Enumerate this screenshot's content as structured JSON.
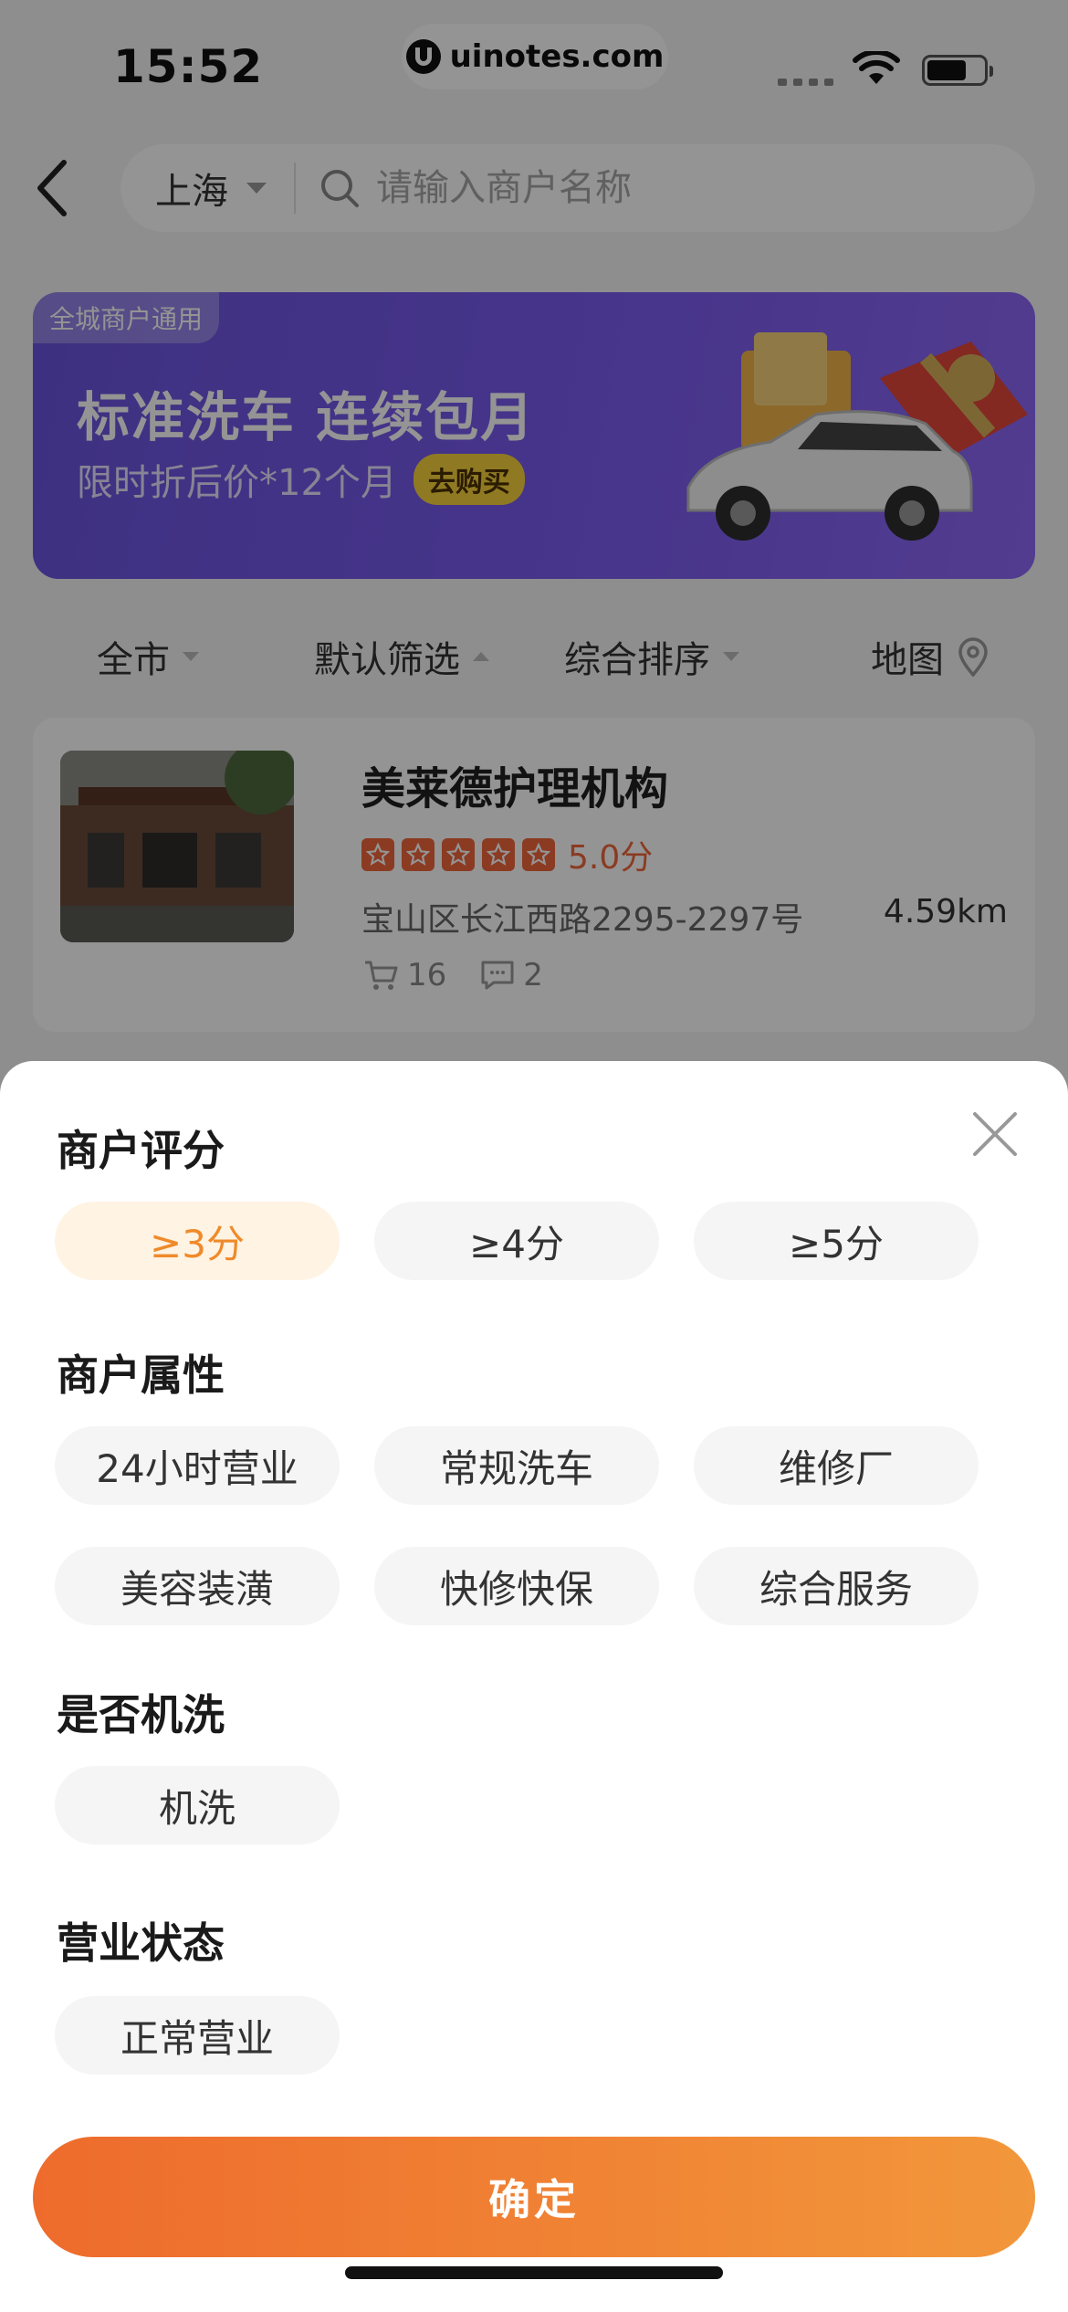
{
  "status_bar": {
    "time": "15:52",
    "watermark": "uinotes.com"
  },
  "search": {
    "city": "上海",
    "placeholder": "请输入商户名称"
  },
  "banner": {
    "tag": "全城商户通用",
    "title": "标准洗车 连续包月",
    "subtitle": "限时折后价*12个月",
    "button": "去购买"
  },
  "filters": [
    {
      "label": "全市"
    },
    {
      "label": "默认筛选"
    },
    {
      "label": "综合排序"
    },
    {
      "label": "地图"
    }
  ],
  "merchant": {
    "name": "美莱德护理机构",
    "rating": 5,
    "rating_max": 5,
    "score_text": "5.0分",
    "address": "宝山区长江西路2295-2297号",
    "distance": "4.59km",
    "orders": "16",
    "comments": "2"
  },
  "sheet": {
    "sections": [
      {
        "title": "商户评分",
        "options": [
          "≥3分",
          "≥4分",
          "≥5分"
        ],
        "selected": "≥3分"
      },
      {
        "title": "商户属性",
        "options": [
          "24小时营业",
          "常规洗车",
          "维修厂",
          "美容装潢",
          "快修快保",
          "综合服务"
        ]
      },
      {
        "title": "是否机洗",
        "options": [
          "机洗"
        ]
      },
      {
        "title": "营业状态",
        "options": [
          "正常营业"
        ]
      }
    ],
    "confirm": "确定"
  },
  "colors": {
    "accent": "#EF8A2A",
    "confirm_start": "#EE6B2C",
    "confirm_end": "#F2973B",
    "banner": "#7A5CF0",
    "star": "#F0663C"
  }
}
